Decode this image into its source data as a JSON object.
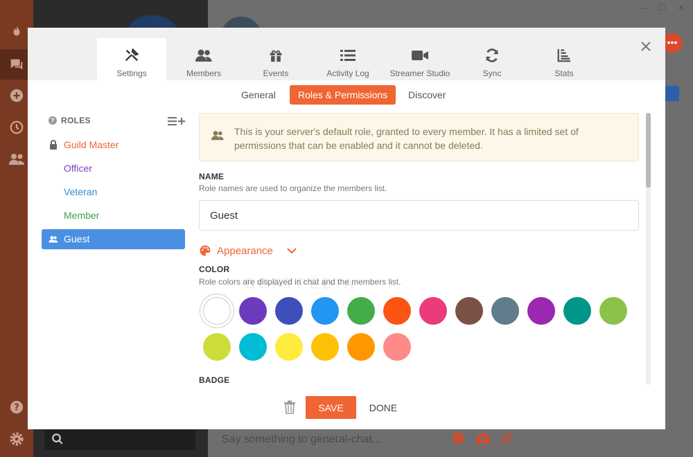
{
  "background": {
    "chat_placeholder": "Say something to general-chat...",
    "rail_icons": [
      "flame-icon",
      "chat-icon",
      "add-server-icon",
      "history-icon",
      "friends-icon",
      "help-icon",
      "gear-icon"
    ],
    "window_controls": [
      "—",
      "☐",
      "✕"
    ],
    "peek_badge": "•••"
  },
  "modal": {
    "tabs": [
      {
        "label": "Settings",
        "icon": "tools-icon"
      },
      {
        "label": "Members",
        "icon": "members-icon"
      },
      {
        "label": "Events",
        "icon": "gift-icon"
      },
      {
        "label": "Activity Log",
        "icon": "list-icon"
      },
      {
        "label": "Streamer Studio",
        "icon": "video-camera-icon"
      },
      {
        "label": "Sync",
        "icon": "sync-icon"
      },
      {
        "label": "Stats",
        "icon": "stats-icon"
      }
    ],
    "active_tab": "Settings",
    "subtabs": [
      "General",
      "Roles & Permissions",
      "Discover"
    ],
    "active_subtab": "Roles & Permissions",
    "roles_header": "ROLES",
    "roles": [
      {
        "label": "Guild Master",
        "color": "#ef6534",
        "icon": "lock-icon"
      },
      {
        "label": "Officer",
        "color": "#7a3fbd",
        "icon": ""
      },
      {
        "label": "Veteran",
        "color": "#2b8fd6",
        "icon": ""
      },
      {
        "label": "Member",
        "color": "#3fa045",
        "icon": ""
      },
      {
        "label": "Guest",
        "color": "#ffffff",
        "icon": "members-icon"
      }
    ],
    "selected_role": "Guest",
    "notice": "This is your server's default role, granted to every member. It has a limited set of permissions that can be enabled and it cannot be deleted.",
    "name_title": "NAME",
    "name_desc": "Role names are used to organize the members list.",
    "name_value": "Guest",
    "appearance_label": "Appearance",
    "color_title": "COLOR",
    "color_desc": "Role colors are displayed in chat and the members list.",
    "colors": [
      "#ffffff",
      "#6c3bbd",
      "#3d4fb8",
      "#2196f3",
      "#43ad4b",
      "#fc5511",
      "#ea3b7b",
      "#7b5146",
      "#617d8b",
      "#9c27b0",
      "#009688",
      "#8bc24a",
      "#cddc39",
      "#00bcd4",
      "#ffeb3b",
      "#ffc107",
      "#ff9800",
      "#fd8a89"
    ],
    "selected_color": "#ffffff",
    "badge_title": "BADGE",
    "save_label": "SAVE",
    "done_label": "DONE"
  }
}
